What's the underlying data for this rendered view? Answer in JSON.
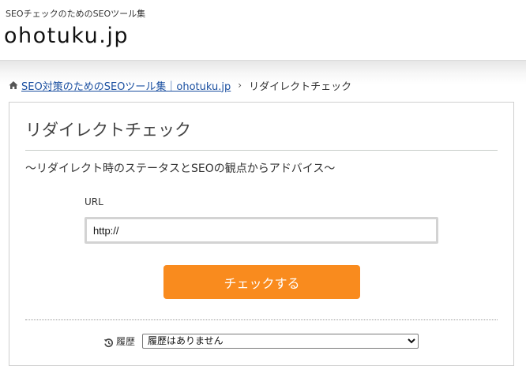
{
  "header": {
    "tagline": "SEOチェックのためのSEOツール集",
    "site_title": "ohotuku.jp"
  },
  "breadcrumb": {
    "home_link": "SEO対策のためのSEOツール集｜ohotuku.jp",
    "separator": "›",
    "current": "リダイレクトチェック"
  },
  "tool": {
    "title": "リダイレクトチェック",
    "subtitle": "～リダイレクト時のステータスとSEOの観点からアドバイス～",
    "url_label": "URL",
    "url_value": "http://",
    "check_button_label": "チェックする"
  },
  "history": {
    "label": "履歴",
    "selected_option": "履歴はありません"
  },
  "colors": {
    "accent_button": "#f98b1e",
    "link": "#1a4fa0"
  },
  "icons": {
    "breadcrumb_home": "home-icon",
    "history": "history-icon"
  }
}
